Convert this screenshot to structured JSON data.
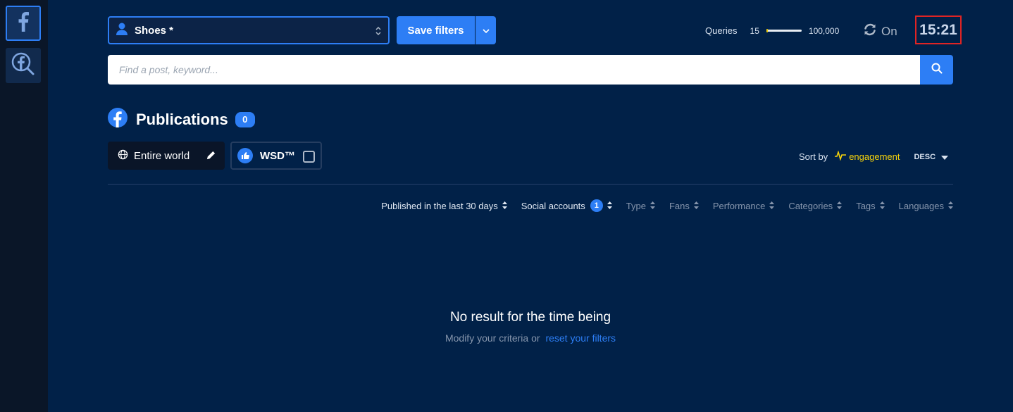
{
  "sidebar": {
    "items": [
      {
        "icon": "facebook-icon"
      },
      {
        "icon": "facebook-search-icon"
      }
    ]
  },
  "header": {
    "account_select": {
      "value": "Shoes *",
      "icon": "user-icon"
    },
    "save_filters_label": "Save filters",
    "queries": {
      "label": "Queries",
      "current": "15",
      "max": "100,000",
      "progress": 0.0002
    },
    "refresh": {
      "label": "On",
      "icon": "refresh-icon"
    },
    "clock": "15:21"
  },
  "search": {
    "placeholder": "Find a post, keyword...",
    "value": "",
    "icon": "search-icon"
  },
  "publications": {
    "title": "Publications",
    "count": "0",
    "icon": "facebook-icon"
  },
  "chips": {
    "location": {
      "label": "Entire world",
      "icon": "globe-icon"
    },
    "wsd": {
      "label": "WSD™",
      "checked": false,
      "icon": "thumbs-up-icon"
    }
  },
  "sort": {
    "label": "Sort by",
    "field": "engagement",
    "direction": "DESC"
  },
  "filters": [
    {
      "label": "Published in the last 30 days",
      "active": true
    },
    {
      "label": "Social accounts",
      "active": true,
      "badge": "1"
    },
    {
      "label": "Type",
      "active": false
    },
    {
      "label": "Fans",
      "active": false
    },
    {
      "label": "Performance",
      "active": false
    },
    {
      "label": "Categories",
      "active": false
    },
    {
      "label": "Tags",
      "active": false
    },
    {
      "label": "Languages",
      "active": false
    }
  ],
  "empty_state": {
    "title": "No result for the time being",
    "subtitle": "Modify your criteria or",
    "link": "reset your filters"
  },
  "colors": {
    "accent": "#2d7ef5",
    "background": "#012148",
    "highlight": "#f5d20b",
    "clock_border": "#e02424"
  }
}
